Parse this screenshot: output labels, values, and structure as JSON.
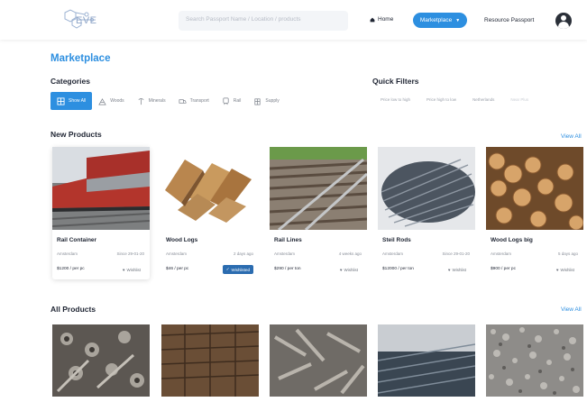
{
  "header": {
    "logo_text": "EVE",
    "search_placeholder": "Search Passport Name / Location / products",
    "nav_home": "Home",
    "nav_marketplace": "Marketplace",
    "nav_resource_passport": "Resource Passport"
  },
  "page_title": "Marketplace",
  "categories": {
    "label": "Categories",
    "items": [
      {
        "label": "Show All",
        "icon": "grid-icon",
        "active": true
      },
      {
        "label": "Woods",
        "icon": "wood-icon"
      },
      {
        "label": "Minerals",
        "icon": "pickaxe-icon"
      },
      {
        "label": "Transport",
        "icon": "truck-icon"
      },
      {
        "label": "Rail",
        "icon": "train-icon"
      },
      {
        "label": "Supply",
        "icon": "supply-icon"
      }
    ]
  },
  "quick_filters": {
    "label": "Quick Filters",
    "items": [
      "Price low to high",
      "Price high to low",
      "Netherlands",
      "Near Plus"
    ]
  },
  "new_products": {
    "label": "New Products",
    "view_all": "View All",
    "items": [
      {
        "name": "Rail Container",
        "location": "Amsterdam",
        "when": "Since 29-01-20",
        "price": "$1200 / per pc",
        "wishlist": "Wishlist",
        "wish_active": false
      },
      {
        "name": "Wood Logs",
        "location": "Amsterdam",
        "when": "2 days ago",
        "price": "$46 / per pc",
        "wishlist": "Wishlisted",
        "wish_active": true
      },
      {
        "name": "Rail Lines",
        "location": "Amsterdam",
        "when": "4 weeks ago",
        "price": "$290 / per ton",
        "wishlist": "Wishlist",
        "wish_active": false
      },
      {
        "name": "Steil Rods",
        "location": "Amsterdam",
        "when": "Since 29-01-20",
        "price": "$12000 / per ton",
        "wishlist": "Wishlist",
        "wish_active": false
      },
      {
        "name": "Wood Logs big",
        "location": "Amsterdam",
        "when": "5 days ago",
        "price": "$900 / per pc",
        "wishlist": "Wishlist",
        "wish_active": false
      }
    ]
  },
  "all_products": {
    "label": "All Products",
    "view_all": "View All"
  },
  "colors": {
    "accent": "#2d8fe0",
    "wishlisted": "#2b6cb0"
  }
}
